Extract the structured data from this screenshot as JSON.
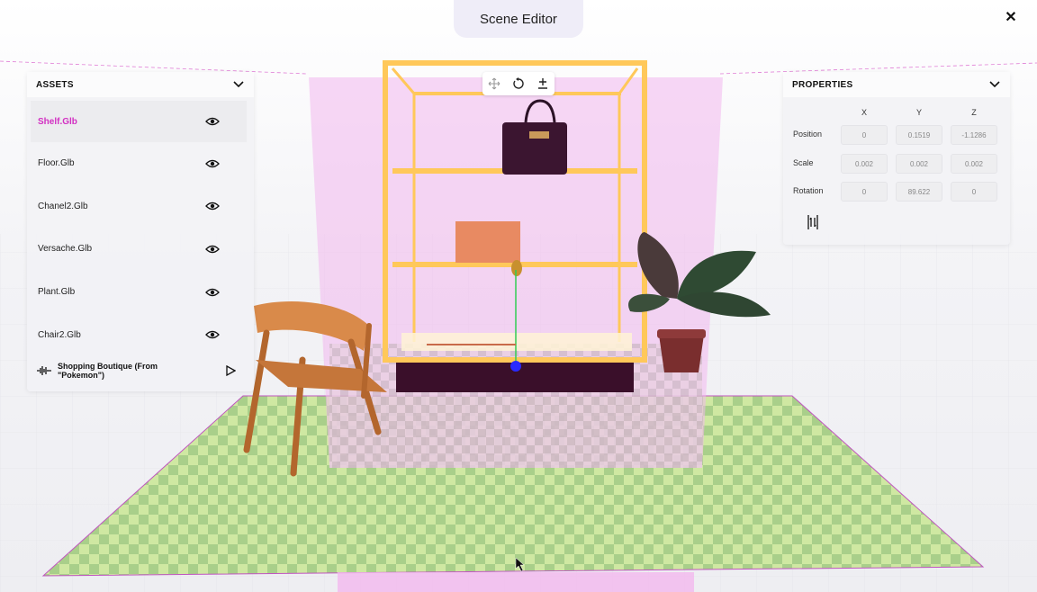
{
  "header": {
    "title": "Scene Editor"
  },
  "assets": {
    "title": "ASSETS",
    "items": [
      {
        "label": "Shelf.Glb",
        "selected": true
      },
      {
        "label": "Floor.Glb",
        "selected": false
      },
      {
        "label": "Chanel2.Glb",
        "selected": false
      },
      {
        "label": "Versache.Glb",
        "selected": false
      },
      {
        "label": "Plant.Glb",
        "selected": false
      },
      {
        "label": "Chair2.Glb",
        "selected": false
      }
    ],
    "audio": {
      "label": "Shopping Boutique (From \"Pokemon\")"
    }
  },
  "properties": {
    "title": "PROPERTIES",
    "columns": [
      "X",
      "Y",
      "Z"
    ],
    "rows": [
      {
        "label": "Position",
        "values": [
          "0",
          "0.1519",
          "-1.1286"
        ]
      },
      {
        "label": "Scale",
        "values": [
          "0.002",
          "0.002",
          "0.002"
        ]
      },
      {
        "label": "Rotation",
        "values": [
          "0",
          "89.622",
          "0"
        ]
      }
    ]
  },
  "colors": {
    "accent": "#d22fc2",
    "shelf_frame": "#ffc85a",
    "selection_volume": "#f2b8ee"
  },
  "icons": {
    "close": "close-icon",
    "collapse": "chevron-down-icon",
    "visibility": "eye-icon",
    "audio": "waveform-icon",
    "play": "play-icon",
    "move": "move-icon",
    "rotate": "rotate-icon",
    "scale": "scale-icon",
    "align": "align-icon"
  }
}
